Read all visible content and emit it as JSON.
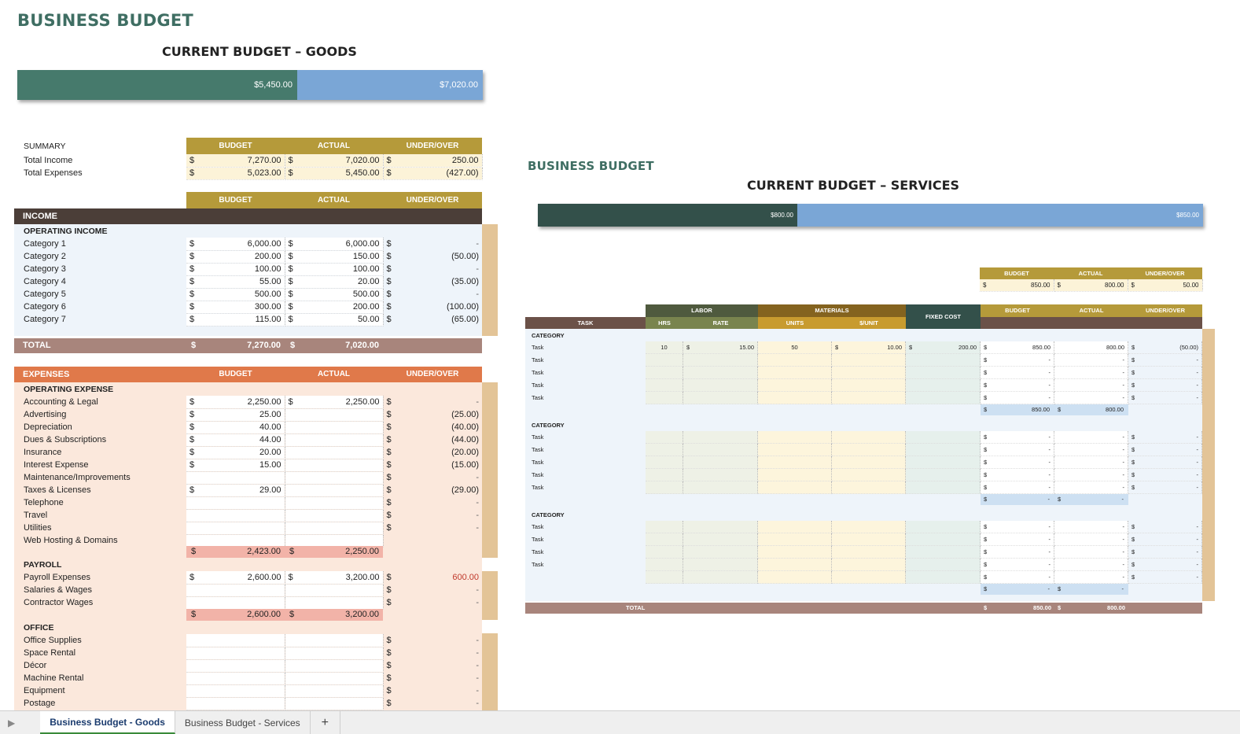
{
  "goods": {
    "title": "BUSINESS BUDGET",
    "subtitle": "CURRENT BUDGET – GOODS",
    "bar": {
      "left_label": "$5,450.00",
      "right_label": "$7,020.00",
      "left_value": 5450,
      "right_value": 7020
    },
    "summary": {
      "label": "SUMMARY",
      "headers": [
        "BUDGET",
        "ACTUAL",
        "UNDER/OVER"
      ],
      "rows": [
        {
          "label": "Total Income",
          "budget": "7,270.00",
          "actual": "7,020.00",
          "diff": "250.00"
        },
        {
          "label": "Total Expenses",
          "budget": "5,023.00",
          "actual": "5,450.00",
          "diff": "(427.00)"
        }
      ]
    },
    "col_headers": [
      "BUDGET",
      "ACTUAL",
      "UNDER/OVER"
    ],
    "income": {
      "label": "INCOME",
      "sub": "OPERATING INCOME",
      "rows": [
        {
          "label": "Category 1",
          "budget": "6,000.00",
          "actual": "6,000.00",
          "diff": "-"
        },
        {
          "label": "Category 2",
          "budget": "200.00",
          "actual": "150.00",
          "diff": "(50.00)"
        },
        {
          "label": "Category 3",
          "budget": "100.00",
          "actual": "100.00",
          "diff": "-"
        },
        {
          "label": "Category 4",
          "budget": "55.00",
          "actual": "20.00",
          "diff": "(35.00)"
        },
        {
          "label": "Category 5",
          "budget": "500.00",
          "actual": "500.00",
          "diff": "-"
        },
        {
          "label": "Category 6",
          "budget": "300.00",
          "actual": "200.00",
          "diff": "(100.00)"
        },
        {
          "label": "Category 7",
          "budget": "115.00",
          "actual": "50.00",
          "diff": "(65.00)"
        }
      ],
      "total_label": "TOTAL",
      "total_budget": "7,270.00",
      "total_actual": "7,020.00"
    },
    "expenses": {
      "label": "EXPENSES",
      "headers": [
        "BUDGET",
        "ACTUAL",
        "UNDER/OVER"
      ],
      "operating": {
        "label": "OPERATING EXPENSE",
        "rows": [
          {
            "label": "Accounting & Legal",
            "budget": "2,250.00",
            "actual": "2,250.00",
            "diff": "-"
          },
          {
            "label": "Advertising",
            "budget": "25.00",
            "actual": "",
            "diff": "(25.00)"
          },
          {
            "label": "Depreciation",
            "budget": "40.00",
            "actual": "",
            "diff": "(40.00)"
          },
          {
            "label": "Dues & Subscriptions",
            "budget": "44.00",
            "actual": "",
            "diff": "(44.00)"
          },
          {
            "label": "Insurance",
            "budget": "20.00",
            "actual": "",
            "diff": "(20.00)"
          },
          {
            "label": "Interest Expense",
            "budget": "15.00",
            "actual": "",
            "diff": "(15.00)"
          },
          {
            "label": "Maintenance/Improvements",
            "budget": "",
            "actual": "",
            "diff": "-"
          },
          {
            "label": "Taxes & Licenses",
            "budget": "29.00",
            "actual": "",
            "diff": "(29.00)"
          },
          {
            "label": "Telephone",
            "budget": "",
            "actual": "",
            "diff": "-"
          },
          {
            "label": "Travel",
            "budget": "",
            "actual": "",
            "diff": "-"
          },
          {
            "label": "Utilities",
            "budget": "",
            "actual": "",
            "diff": "-"
          },
          {
            "label": "Web Hosting & Domains",
            "budget": "",
            "actual": "",
            "diff": ""
          }
        ],
        "subtotal_budget": "2,423.00",
        "subtotal_actual": "2,250.00"
      },
      "payroll": {
        "label": "PAYROLL",
        "rows": [
          {
            "label": "Payroll Expenses",
            "budget": "2,600.00",
            "actual": "3,200.00",
            "diff": "600.00"
          },
          {
            "label": "Salaries & Wages",
            "budget": "",
            "actual": "",
            "diff": "-"
          },
          {
            "label": "Contractor Wages",
            "budget": "",
            "actual": "",
            "diff": "-"
          }
        ],
        "subtotal_budget": "2,600.00",
        "subtotal_actual": "3,200.00"
      },
      "office": {
        "label": "OFFICE",
        "rows": [
          {
            "label": "Office Supplies",
            "budget": "",
            "actual": "",
            "diff": "-"
          },
          {
            "label": "Space Rental",
            "budget": "",
            "actual": "",
            "diff": "-"
          },
          {
            "label": "Décor",
            "budget": "",
            "actual": "",
            "diff": "-"
          },
          {
            "label": "Machine Rental",
            "budget": "",
            "actual": "",
            "diff": "-"
          },
          {
            "label": "Equipment",
            "budget": "",
            "actual": "",
            "diff": "-"
          },
          {
            "label": "Postage",
            "budget": "",
            "actual": "",
            "diff": "-"
          }
        ]
      }
    }
  },
  "services": {
    "title": "BUSINESS BUDGET",
    "subtitle": "CURRENT BUDGET – SERVICES",
    "bar": {
      "left_label": "$800.00",
      "right_label": "$850.00",
      "left_value": 800,
      "right_value": 850
    },
    "summary": {
      "headers": [
        "BUDGET",
        "ACTUAL",
        "UNDER/OVER"
      ],
      "budget": "850.00",
      "actual": "800.00",
      "diff": "50.00"
    },
    "group_headers": {
      "labor": "LABOR",
      "materials": "MATERIALS",
      "fixed": "FIXED COST",
      "budget": "BUDGET",
      "actual": "ACTUAL",
      "diff": "UNDER/OVER"
    },
    "sub_headers": {
      "task": "TASK",
      "hrs": "HRS",
      "rate": "RATE",
      "units": "UNITS",
      "per_unit": "$/UNIT"
    },
    "categories": [
      {
        "label": "CATEGORY",
        "rows": [
          {
            "task": "Task",
            "hrs": "10",
            "rate": "15.00",
            "units": "50",
            "per_unit": "10.00",
            "fixed": "200.00",
            "budget": "850.00",
            "actual": "800.00",
            "diff": "(50.00)"
          },
          {
            "task": "Task",
            "hrs": "",
            "rate": "",
            "units": "",
            "per_unit": "",
            "fixed": "",
            "budget": "-",
            "actual": "-",
            "diff": "-"
          },
          {
            "task": "Task",
            "hrs": "",
            "rate": "",
            "units": "",
            "per_unit": "",
            "fixed": "",
            "budget": "-",
            "actual": "-",
            "diff": "-"
          },
          {
            "task": "Task",
            "hrs": "",
            "rate": "",
            "units": "",
            "per_unit": "",
            "fixed": "",
            "budget": "-",
            "actual": "-",
            "diff": "-"
          },
          {
            "task": "Task",
            "hrs": "",
            "rate": "",
            "units": "",
            "per_unit": "",
            "fixed": "",
            "budget": "-",
            "actual": "-",
            "diff": "-"
          }
        ],
        "subtotal_budget": "850.00",
        "subtotal_actual": "800.00"
      },
      {
        "label": "CATEGORY",
        "rows": [
          {
            "task": "Task",
            "hrs": "",
            "rate": "",
            "units": "",
            "per_unit": "",
            "fixed": "",
            "budget": "-",
            "actual": "-",
            "diff": "-"
          },
          {
            "task": "Task",
            "hrs": "",
            "rate": "",
            "units": "",
            "per_unit": "",
            "fixed": "",
            "budget": "-",
            "actual": "-",
            "diff": "-"
          },
          {
            "task": "Task",
            "hrs": "",
            "rate": "",
            "units": "",
            "per_unit": "",
            "fixed": "",
            "budget": "-",
            "actual": "-",
            "diff": "-"
          },
          {
            "task": "Task",
            "hrs": "",
            "rate": "",
            "units": "",
            "per_unit": "",
            "fixed": "",
            "budget": "-",
            "actual": "-",
            "diff": "-"
          },
          {
            "task": "Task",
            "hrs": "",
            "rate": "",
            "units": "",
            "per_unit": "",
            "fixed": "",
            "budget": "-",
            "actual": "-",
            "diff": "-"
          }
        ],
        "subtotal_budget": "-",
        "subtotal_actual": "-"
      },
      {
        "label": "CATEGORY",
        "rows": [
          {
            "task": "Task",
            "hrs": "",
            "rate": "",
            "units": "",
            "per_unit": "",
            "fixed": "",
            "budget": "-",
            "actual": "-",
            "diff": "-"
          },
          {
            "task": "Task",
            "hrs": "",
            "rate": "",
            "units": "",
            "per_unit": "",
            "fixed": "",
            "budget": "-",
            "actual": "-",
            "diff": "-"
          },
          {
            "task": "Task",
            "hrs": "",
            "rate": "",
            "units": "",
            "per_unit": "",
            "fixed": "",
            "budget": "-",
            "actual": "-",
            "diff": "-"
          },
          {
            "task": "Task",
            "hrs": "",
            "rate": "",
            "units": "",
            "per_unit": "",
            "fixed": "",
            "budget": "-",
            "actual": "-",
            "diff": "-"
          },
          {
            "task": "",
            "hrs": "",
            "rate": "",
            "units": "",
            "per_unit": "",
            "fixed": "",
            "budget": "-",
            "actual": "-",
            "diff": "-"
          }
        ],
        "subtotal_budget": "-",
        "subtotal_actual": "-"
      }
    ],
    "total": {
      "label": "TOTAL",
      "budget": "850.00",
      "actual": "800.00"
    }
  },
  "tabs": {
    "items": [
      "Business Budget - Goods",
      "Business Budget - Services"
    ],
    "add": "+"
  },
  "currency": "$",
  "colors": {
    "title_green": "#3f6e63",
    "bar_green": "#467a6c",
    "bar_blue": "#7aa6d6",
    "gold": "#b59a3a",
    "income_dark": "#4b3e38",
    "income_bg": "#eef4fa",
    "total_mauve": "#a8857c",
    "expense_orange": "#e0794a",
    "expense_bg": "#fbe8dc",
    "subtotal_pink": "#f2b3a8",
    "sidebar_tan": "#e3c497",
    "labor_dark": "#4f5a3e",
    "materials_brown": "#84631f",
    "fixed_dark": "#33504a"
  }
}
